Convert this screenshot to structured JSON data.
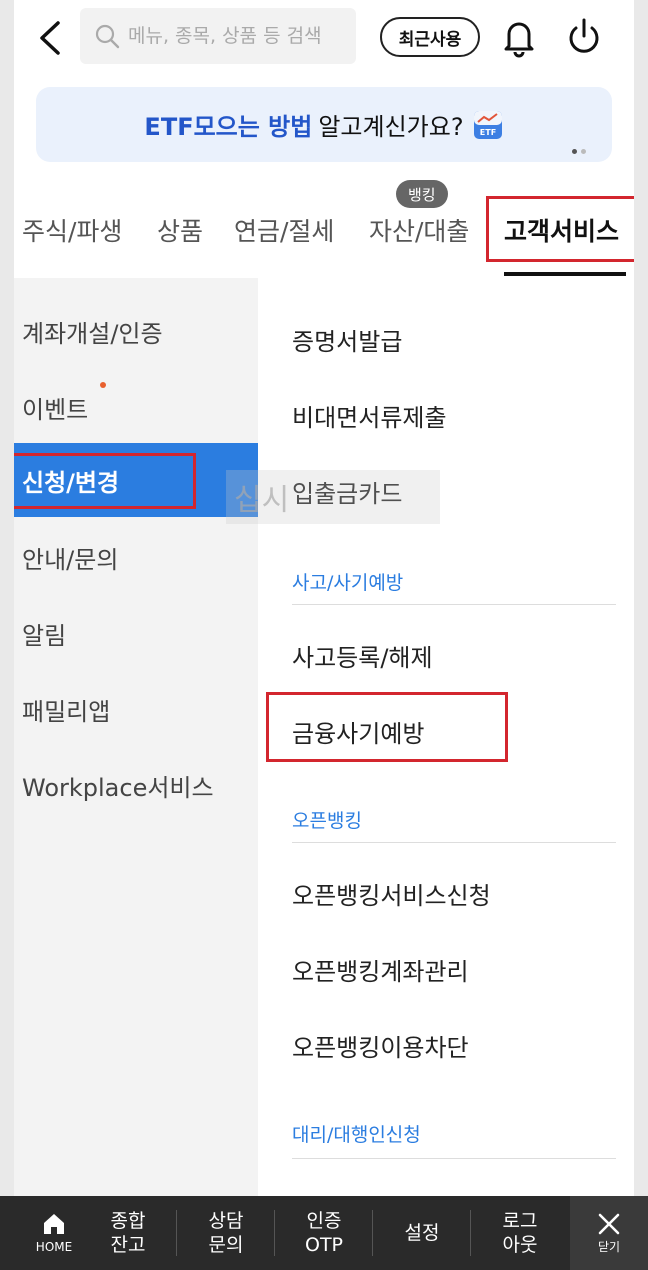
{
  "header": {
    "search_placeholder": "메뉴, 종목, 상품 등 검색",
    "recent_label": "최근사용"
  },
  "banner": {
    "highlight": "ETF모으는 방법",
    "rest": "알고계신가요?",
    "icon_text": "ETF"
  },
  "tabs": {
    "items": [
      "주식/파생",
      "상품",
      "연금/절세",
      "자산/대출",
      "고객서비스"
    ],
    "badge": "뱅킹",
    "active": "고객서비스"
  },
  "leftnav": {
    "items": [
      "계좌개설/인증",
      "이벤트",
      "신청/변경",
      "안내/문의",
      "알림",
      "패밀리앱",
      "Workplace서비스"
    ],
    "active": "신청/변경"
  },
  "content": {
    "items_top": [
      "증명서발급",
      "비대면서류제출",
      "입출금카드"
    ],
    "section1": "사고/사기예방",
    "items_s1": [
      "사고등록/해제",
      "금융사기예방"
    ],
    "section2": "오픈뱅킹",
    "items_s2": [
      "오픈뱅킹서비스신청",
      "오픈뱅킹계좌관리",
      "오픈뱅킹이용차단"
    ],
    "section3": "대리/대행인신청"
  },
  "bottombar": {
    "home": "HOME",
    "items": [
      {
        "line1": "종합",
        "line2": "잔고"
      },
      {
        "line1": "상담",
        "line2": "문의"
      },
      {
        "line1": "인증",
        "line2": "OTP"
      },
      {
        "line1": "설정",
        "line2": ""
      },
      {
        "line1": "로그",
        "line2": "아웃"
      }
    ],
    "close": "닫기"
  },
  "colors": {
    "accent": "#2b7de0",
    "banner_bg": "#eaf1fc",
    "highlight_box": "#d3262e",
    "bottombar_bg": "#2a2a2a"
  }
}
